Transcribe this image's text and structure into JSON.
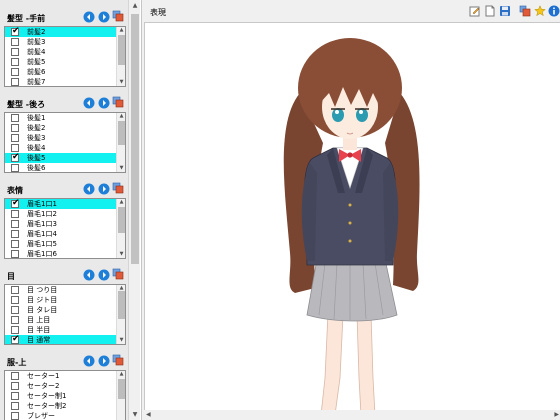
{
  "groups": [
    {
      "title": "髪型 -手前",
      "items": [
        {
          "label": "前髪2",
          "checked": true,
          "selected": true
        },
        {
          "label": "前髪3",
          "checked": false,
          "selected": false
        },
        {
          "label": "前髪4",
          "checked": false,
          "selected": false
        },
        {
          "label": "前髪5",
          "checked": false,
          "selected": false
        },
        {
          "label": "前髪6",
          "checked": false,
          "selected": false
        },
        {
          "label": "前髪7",
          "checked": false,
          "selected": false
        }
      ]
    },
    {
      "title": "髪型 -後ろ",
      "items": [
        {
          "label": "後髪1",
          "checked": false,
          "selected": false
        },
        {
          "label": "後髪2",
          "checked": false,
          "selected": false
        },
        {
          "label": "後髪3",
          "checked": false,
          "selected": false
        },
        {
          "label": "後髪4",
          "checked": false,
          "selected": false
        },
        {
          "label": "後髪5",
          "checked": true,
          "selected": true
        },
        {
          "label": "後髪6",
          "checked": false,
          "selected": false
        }
      ]
    },
    {
      "title": "表情",
      "items": [
        {
          "label": "眉毛1口1",
          "checked": true,
          "selected": true
        },
        {
          "label": "眉毛1口2",
          "checked": false,
          "selected": false
        },
        {
          "label": "眉毛1口3",
          "checked": false,
          "selected": false
        },
        {
          "label": "眉毛1口4",
          "checked": false,
          "selected": false
        },
        {
          "label": "眉毛1口5",
          "checked": false,
          "selected": false
        },
        {
          "label": "眉毛1口6",
          "checked": false,
          "selected": false
        }
      ]
    },
    {
      "title": "目",
      "items": [
        {
          "label": "目 つり目",
          "checked": false,
          "selected": false
        },
        {
          "label": "目 ジト目",
          "checked": false,
          "selected": false
        },
        {
          "label": "目 タレ目",
          "checked": false,
          "selected": false
        },
        {
          "label": "目 上目",
          "checked": false,
          "selected": false
        },
        {
          "label": "目 半目",
          "checked": false,
          "selected": false
        },
        {
          "label": "目 通常",
          "checked": true,
          "selected": true
        }
      ]
    },
    {
      "title": "服-上",
      "items": [
        {
          "label": "セーター1",
          "checked": false,
          "selected": false
        },
        {
          "label": "セーター2",
          "checked": false,
          "selected": false
        },
        {
          "label": "セーター制1",
          "checked": false,
          "selected": false
        },
        {
          "label": "セーター制2",
          "checked": false,
          "selected": false
        },
        {
          "label": "ブレザー",
          "checked": false,
          "selected": false
        }
      ]
    }
  ],
  "preview": {
    "title": "表現"
  },
  "colors": {
    "selected_row": "#12f0f0",
    "nav_button": "#1e7fd8",
    "panel_bg": "#e9e9e9"
  },
  "icons": {
    "group_buttons": [
      "prev-arrow-icon",
      "next-arrow-icon",
      "copy-layers-icon"
    ],
    "toolbar": [
      "edit-icon",
      "new-page-icon",
      "save-icon",
      "layers-icon",
      "star-icon",
      "info-icon"
    ]
  }
}
